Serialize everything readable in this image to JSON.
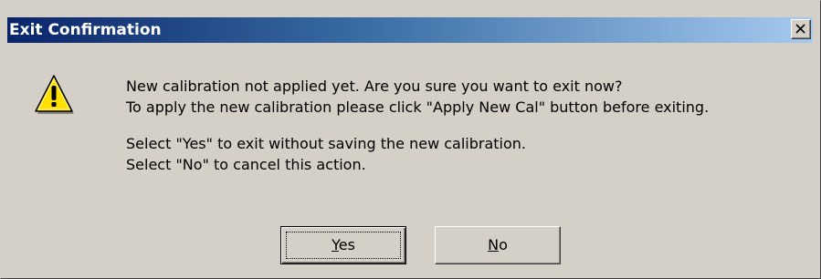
{
  "window": {
    "title": "Exit Confirmation",
    "close_label": "×"
  },
  "icon": "warning-icon",
  "message": {
    "line1": "New calibration not applied yet. Are you sure you want to exit now?",
    "line2": "To apply the new calibration please click \"Apply New Cal\" button before exiting.",
    "line3": "Select \"Yes\" to exit without saving the new calibration.",
    "line4": "Select \"No\" to cancel this action."
  },
  "buttons": {
    "yes": {
      "mnemonic": "Y",
      "rest": "es"
    },
    "no": {
      "mnemonic": "N",
      "rest": "o"
    }
  },
  "colors": {
    "title_start": "#0a246a",
    "title_end": "#a6caf0",
    "dialog_bg": "#d4d0c8",
    "warning_yellow": "#ffe000"
  }
}
